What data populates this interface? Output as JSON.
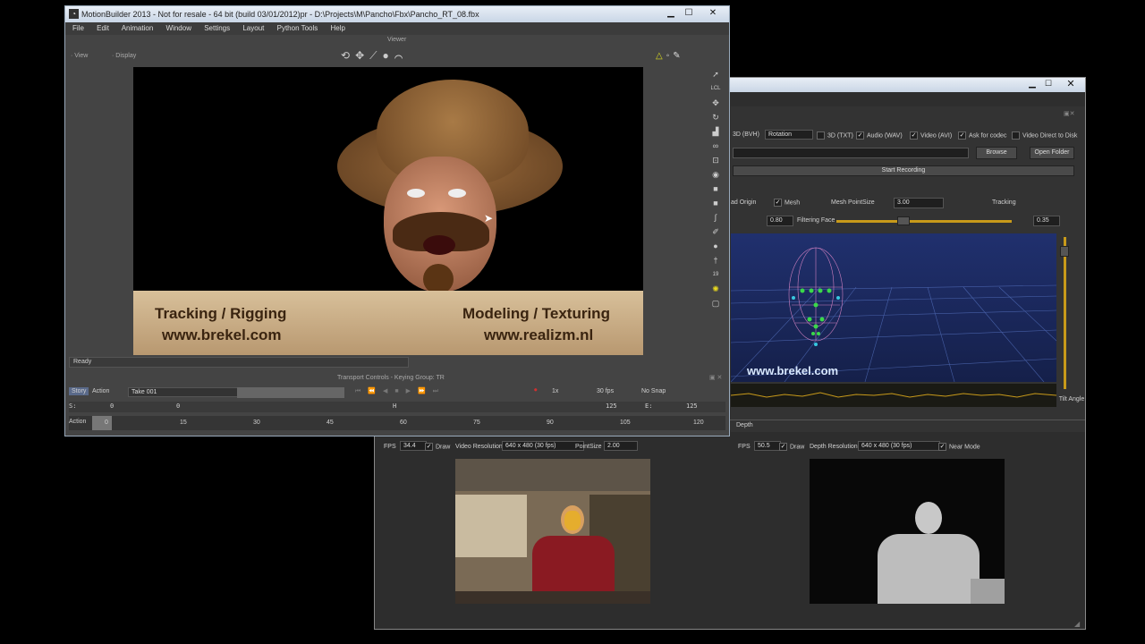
{
  "mb": {
    "title": "MotionBuilder 2013 - Not for resale - 64 bit (build 03/01/2012)pr - D:\\Projects\\M\\Pancho\\Fbx\\Pancho_RT_08.fbx",
    "menu": [
      "File",
      "Edit",
      "Animation",
      "Window",
      "Settings",
      "Layout",
      "Python Tools",
      "Help"
    ],
    "viewer_label": "Viewer",
    "view_btn": "View",
    "display_btn": "Display",
    "overlay_left_1": "Tracking / Rigging",
    "overlay_left_2": "www.brekel.com",
    "overlay_right_1": "Modeling / Texturing",
    "overlay_right_2": "www.realizm.nl",
    "status": "Ready",
    "transport_title": "Transport Controls - Keying Group: TR",
    "story": "Story",
    "action": "Action",
    "take": "Take 001",
    "speed": "1x",
    "fps": "30 fps",
    "snap": "No Snap",
    "start_label": "S:",
    "start_val": "0",
    "cur_val": "0",
    "mid_mark": "H",
    "end_val": "125",
    "end_label": "E:",
    "end_val2": "125",
    "action_label": "Action",
    "ticks": [
      "0",
      "15",
      "30",
      "45",
      "60",
      "75",
      "90",
      "105",
      "120"
    ]
  },
  "brekel": {
    "export_items": [
      "3D (BVH)",
      "Rotation",
      "3D (TXT)",
      "Audio (WAV)",
      "Video (AVI)",
      "Ask for codec",
      "Video Direct to Disk"
    ],
    "browse": "Browse",
    "open_folder": "Open Folder",
    "start_recording": "Start Recording",
    "load_origin": "ad Origin",
    "mesh": "Mesh",
    "mesh_pointsize_label": "Mesh PointSize",
    "mesh_pointsize_val": "3.00",
    "tracking": "Tracking",
    "filter_val": "0.80",
    "filtering_face": "Filtering Face",
    "face_val": "0.35",
    "watermark": "www.brekel.com",
    "tilt": "Tilt Angle",
    "depth_title": "Depth",
    "fps_label": "FPS",
    "fps_val_left": "34.4",
    "draw": "Draw",
    "video_res_label": "Video Resolution",
    "video_res_val": "640 x 480 (30 fps)",
    "pointsize_label": "PointSize",
    "pointsize_val": "2.00",
    "fps_val_right": "50.5",
    "depth_res_label": "Depth Resolution",
    "depth_res_val": "640 x 480 (30 fps)",
    "near_mode": "Near Mode"
  },
  "colors": {
    "accent_orange": "#c89a1a",
    "win_blue_bar": "#d6e2f0",
    "grid_blue": "#1c2a6e"
  }
}
